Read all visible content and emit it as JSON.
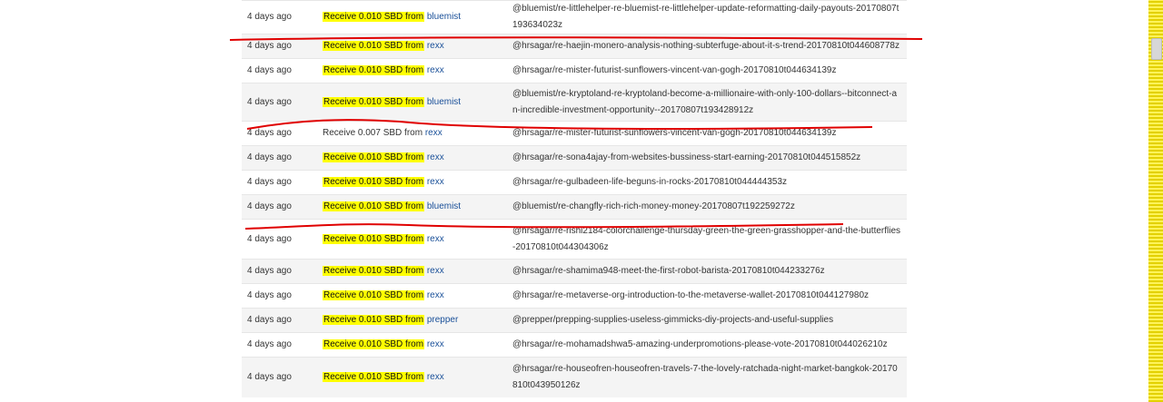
{
  "transfers": [
    {
      "time": "4 days ago",
      "action": "Receive 0.010 SBD from",
      "from": "bluemist",
      "memo": "@bluemist/re-littlehelper-re-bluemist-re-littlehelper-update-reformatting-daily-payouts-20170807t193634023z",
      "highlight": true
    },
    {
      "time": "4 days ago",
      "action": "Receive 0.010 SBD from",
      "from": "rexx",
      "memo": "@hrsagar/re-haejin-monero-analysis-nothing-subterfuge-about-it-s-trend-20170810t044608778z",
      "highlight": true
    },
    {
      "time": "4 days ago",
      "action": "Receive 0.010 SBD from",
      "from": "rexx",
      "memo": "@hrsagar/re-mister-futurist-sunflowers-vincent-van-gogh-20170810t044634139z",
      "highlight": true
    },
    {
      "time": "4 days ago",
      "action": "Receive 0.010 SBD from",
      "from": "bluemist",
      "memo": "@bluemist/re-kryptoland-re-kryptoland-become-a-millionaire-with-only-100-dollars--bitconnect-an-incredible-investment-opportunity--20170807t193428912z",
      "highlight": true
    },
    {
      "time": "4 days ago",
      "action": "Receive 0.007 SBD from",
      "from": "rexx",
      "memo": "@hrsagar/re-mister-futurist-sunflowers-vincent-van-gogh-20170810t044634139z",
      "highlight": false
    },
    {
      "time": "4 days ago",
      "action": "Receive 0.010 SBD from",
      "from": "rexx",
      "memo": "@hrsagar/re-sona4ajay-from-websites-bussiness-start-earning-20170810t044515852z",
      "highlight": true
    },
    {
      "time": "4 days ago",
      "action": "Receive 0.010 SBD from",
      "from": "rexx",
      "memo": "@hrsagar/re-gulbadeen-life-beguns-in-rocks-20170810t044444353z",
      "highlight": true
    },
    {
      "time": "4 days ago",
      "action": "Receive 0.010 SBD from",
      "from": "bluemist",
      "memo": "@bluemist/re-changfly-rich-rich-money-money-20170807t192259272z",
      "highlight": true
    },
    {
      "time": "4 days ago",
      "action": "Receive 0.010 SBD from",
      "from": "rexx",
      "memo": "@hrsagar/re-rishi2184-colorchallenge-thursday-green-the-green-grasshopper-and-the-butterflies-20170810t044304306z",
      "highlight": true
    },
    {
      "time": "4 days ago",
      "action": "Receive 0.010 SBD from",
      "from": "rexx",
      "memo": "@hrsagar/re-shamima948-meet-the-first-robot-barista-20170810t044233276z",
      "highlight": true
    },
    {
      "time": "4 days ago",
      "action": "Receive 0.010 SBD from",
      "from": "rexx",
      "memo": "@hrsagar/re-metaverse-org-introduction-to-the-metaverse-wallet-20170810t044127980z",
      "highlight": true
    },
    {
      "time": "4 days ago",
      "action": "Receive 0.010 SBD from",
      "from": "prepper",
      "memo": "@prepper/prepping-supplies-useless-gimmicks-diy-projects-and-useful-supplies",
      "highlight": true
    },
    {
      "time": "4 days ago",
      "action": "Receive 0.010 SBD from",
      "from": "rexx",
      "memo": "@hrsagar/re-mohamadshwa5-amazing-underpromotions-please-vote-20170810t044026210z",
      "highlight": true
    },
    {
      "time": "4 days ago",
      "action": "Receive 0.010 SBD from",
      "from": "rexx",
      "memo": "@hrsagar/re-houseofren-houseofren-travels-7-the-lovely-ratchada-night-market-bangkok-20170810t043950126z",
      "highlight": true
    }
  ],
  "colors": {
    "highlight": "#ffff00",
    "link": "#1a5099",
    "annotation": "#e00000",
    "scrollbar": "#e3d100"
  }
}
